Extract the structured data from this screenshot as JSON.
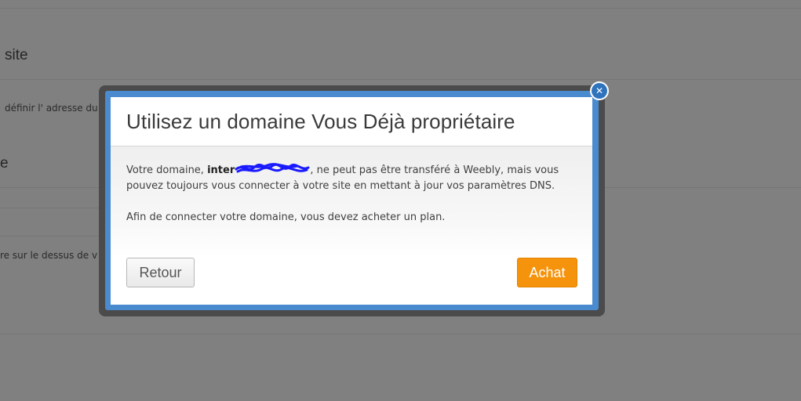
{
  "background": {
    "heading_site": "site",
    "desc_define": "définir l' adresse du",
    "heading_e": "e",
    "desc_dessus": "re sur le dessus de v"
  },
  "modal": {
    "title": "Utilisez un domaine Vous Déjà propriétaire",
    "body": {
      "line1_prefix": "Votre domaine, ",
      "domain_visible": "inter",
      "line1_suffix": " , ne peut pas être transféré à Weebly, mais vous",
      "line2": "pouvez toujours vous connecter à votre site en mettant à jour vos paramètres DNS.",
      "paragraph2": "Afin de connecter votre domaine, vous devez acheter un plan."
    },
    "buttons": {
      "back_label": "Retour",
      "buy_label": "Achat"
    },
    "close_icon": "close-icon"
  },
  "colors": {
    "overlay": "#808080",
    "accent_blue": "#4a8bd0",
    "buy_orange": "#f5930c",
    "close_blue": "#2f73bd"
  }
}
